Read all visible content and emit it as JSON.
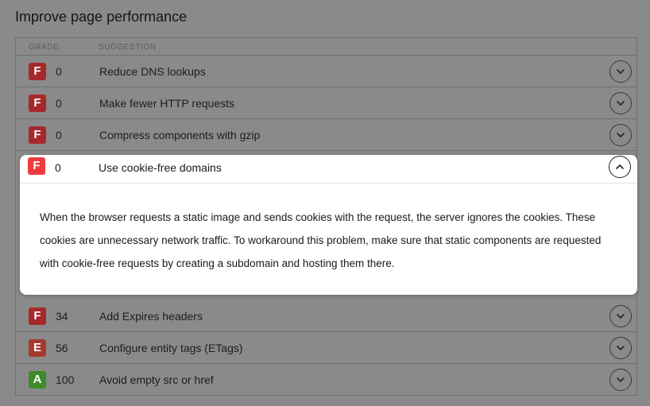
{
  "page_title": "Improve page performance",
  "table": {
    "headers": {
      "grade": "GRADE",
      "suggestion": "SUGGESTION"
    },
    "rows": [
      {
        "grade": "F",
        "score": "0",
        "suggestion": "Reduce DNS lookups"
      },
      {
        "grade": "F",
        "score": "0",
        "suggestion": "Make fewer HTTP requests"
      },
      {
        "grade": "F",
        "score": "0",
        "suggestion": "Compress components with gzip"
      },
      {
        "grade": "F",
        "score": "34",
        "suggestion": "Add Expires headers"
      },
      {
        "grade": "E",
        "score": "56",
        "suggestion": "Configure entity tags (ETags)"
      },
      {
        "grade": "A",
        "score": "100",
        "suggestion": "Avoid empty src or href"
      }
    ]
  },
  "expanded": {
    "grade": "F",
    "score": "0",
    "suggestion": "Use cookie-free domains",
    "description": "When the browser requests a static image and sends cookies with the request, the server ignores the cookies. These cookies are unnecessary network traffic. To workaround this problem, make sure that static components are requested with cookie-free requests by creating a subdomain and hosting them there."
  },
  "colors": {
    "grade_F": "#a6282a",
    "grade_F_active": "#ee3b3f",
    "grade_E": "#a63a2f",
    "grade_A": "#3f8a2a"
  },
  "icons": {
    "collapsed": "chevron-down-icon",
    "expanded": "chevron-up-icon"
  }
}
